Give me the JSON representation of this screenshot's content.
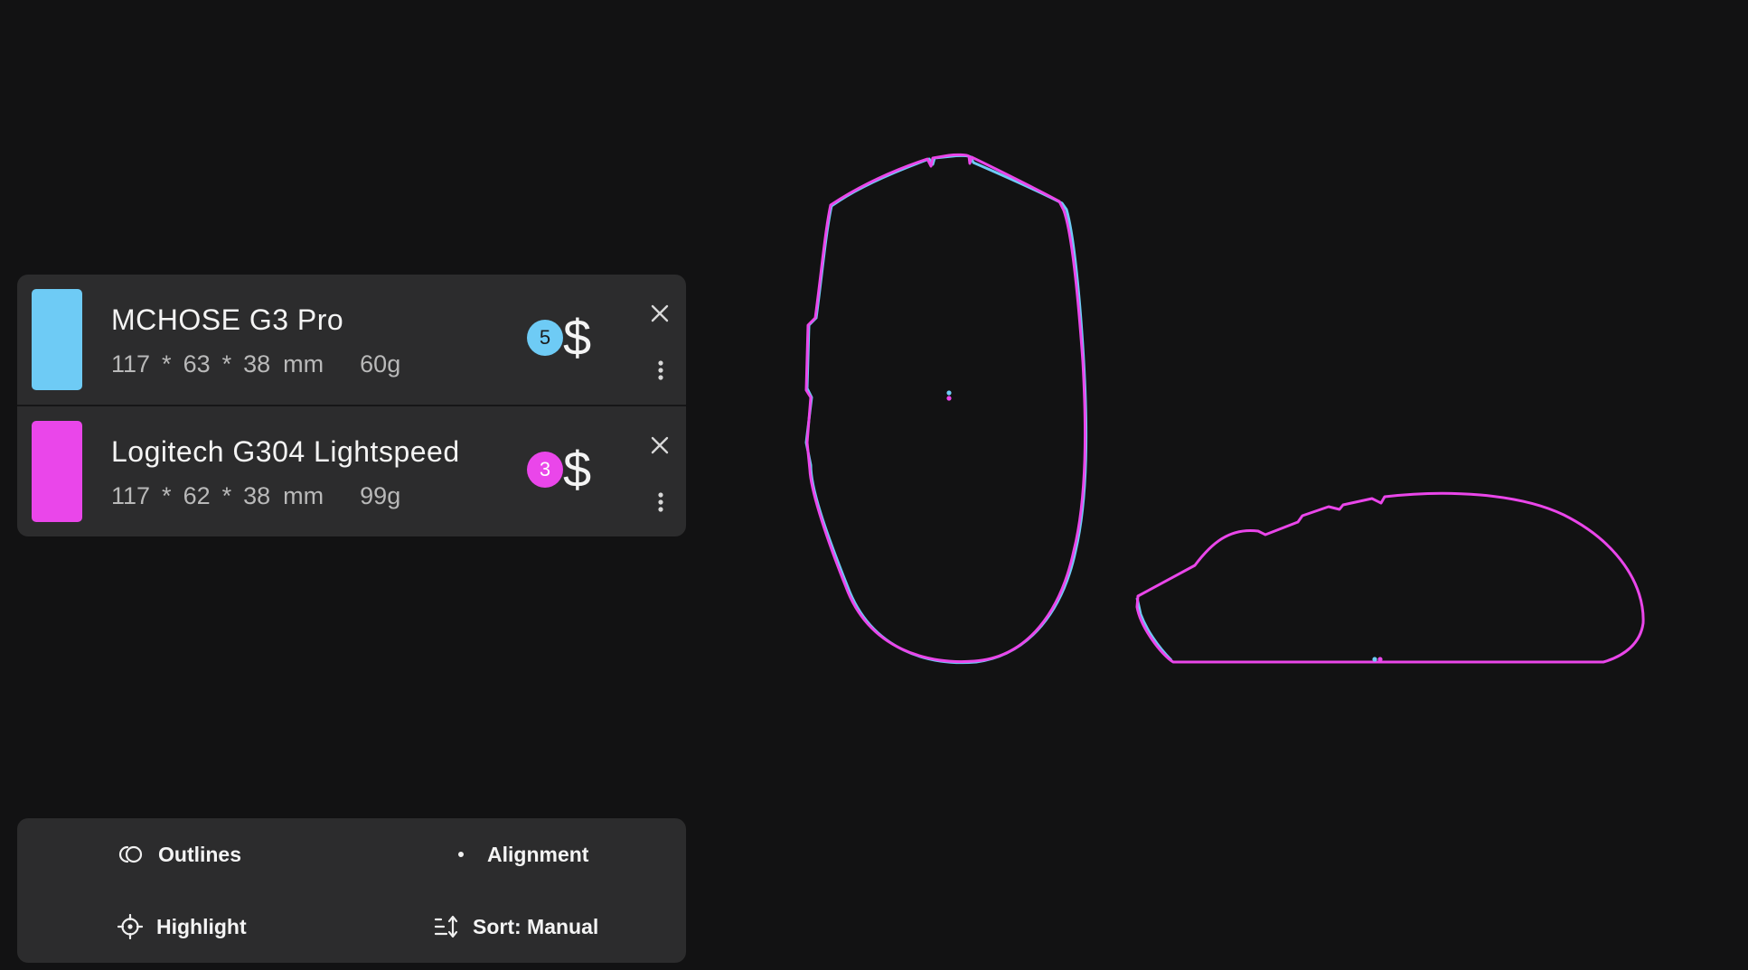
{
  "mice": [
    {
      "name": "MCHOSE G3 Pro",
      "length": "117",
      "width": "63",
      "height": "38",
      "unit": "mm",
      "weight": "60g",
      "rank": "5",
      "price_symbol": "$",
      "color": "#6ecbf5"
    },
    {
      "name": "Logitech G304 Lightspeed",
      "length": "117",
      "width": "62",
      "height": "38",
      "unit": "mm",
      "weight": "99g",
      "rank": "3",
      "price_symbol": "$",
      "color": "#ea46ea"
    }
  ],
  "dimension_separator": "*",
  "toolbar": {
    "outlines_label": "Outlines",
    "alignment_label": "Alignment",
    "highlight_label": "Highlight",
    "sort_label": "Sort: Manual"
  },
  "icons": {
    "close": "close-icon",
    "menu": "more-vert-icon",
    "outlines": "outlines-icon",
    "alignment": "dot-icon",
    "highlight": "crosshair-icon",
    "sort": "sort-icon"
  },
  "colors": {
    "background": "#121213",
    "panel": "#2c2c2d",
    "outline_primary": "#ea46ea",
    "outline_secondary": "#6ecbf5"
  }
}
